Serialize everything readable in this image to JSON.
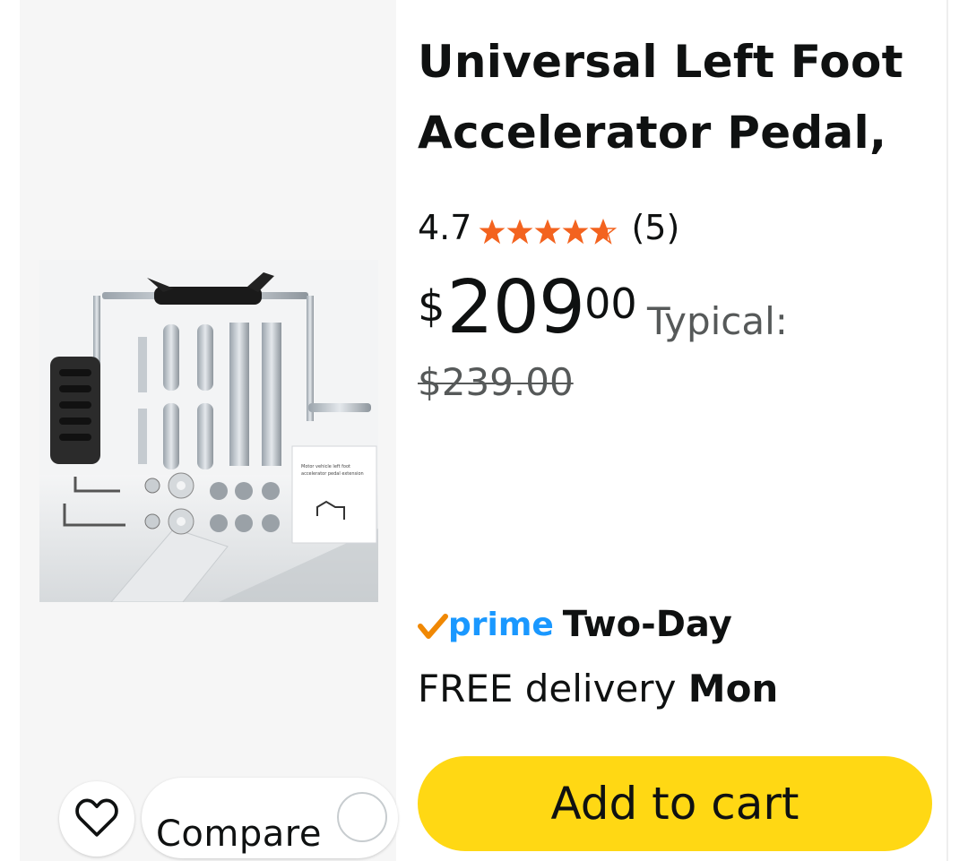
{
  "product": {
    "title": "Universal Left Foot Accelerator Pedal, Assist for Handicap",
    "rating_value": "4.7",
    "rating_stars": 4.7,
    "rating_count": "(5)",
    "price_symbol": "$",
    "price_whole": "209",
    "price_fraction": "00",
    "typical_label": "Typical:",
    "typical_price": "$239.00"
  },
  "delivery": {
    "prime_word": "prime",
    "prime_speed": "Two-Day",
    "free_text": "FREE delivery",
    "day": "Mon"
  },
  "actions": {
    "add_to_cart": "Add to cart",
    "compare": "Compare"
  },
  "image": {
    "manual_text": "Motor vehicle left foot accelerator pedal extension"
  },
  "colors": {
    "accent_yellow": "#ffd814",
    "star_orange": "#f3631f",
    "prime_blue": "#1a98ff",
    "prime_check": "#f08804"
  },
  "icons": {
    "wishlist": "heart-outline-icon",
    "prime": "prime-check-icon",
    "star": "star-icon"
  }
}
